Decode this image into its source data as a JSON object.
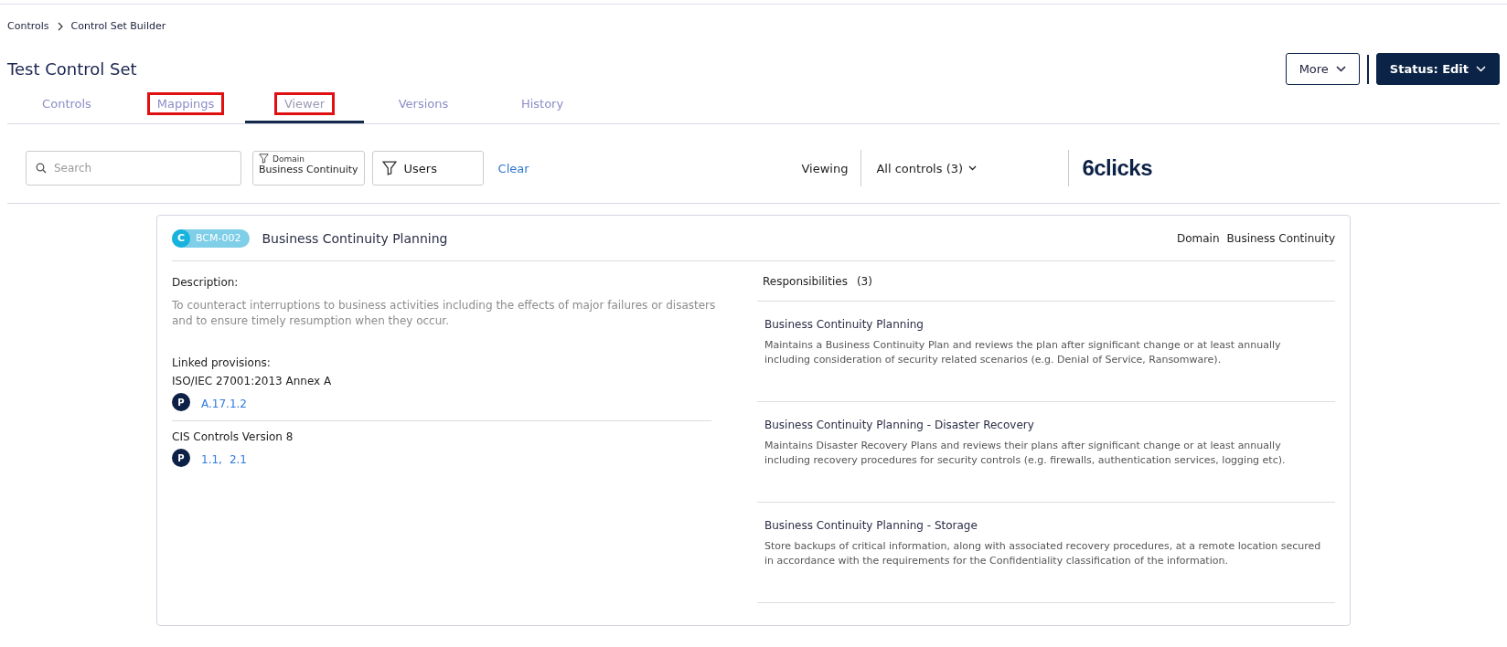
{
  "breadcrumb": [
    {
      "label": "Controls"
    },
    {
      "label": "Control Set Builder"
    }
  ],
  "title": "Test Control Set",
  "header_buttons": [
    {
      "label": "More",
      "kind": "outline"
    },
    {
      "label": "Status: Edit",
      "kind": "solid"
    }
  ],
  "tabs": [
    {
      "label": "Controls",
      "selected": false,
      "highlighted": false
    },
    {
      "label": "Mappings",
      "selected": false,
      "highlighted": true
    },
    {
      "label": "Viewer",
      "selected": true,
      "highlighted": true
    },
    {
      "label": "Versions",
      "selected": false,
      "highlighted": false
    },
    {
      "label": "History",
      "selected": false,
      "highlighted": false
    }
  ],
  "filters": {
    "search_placeholder": "Search",
    "domain_filter": {
      "caption": "Domain",
      "value": "Business Continuity"
    },
    "users_filter": "Users",
    "clear": "Clear",
    "viewing_label": "Viewing",
    "viewing_value": "All controls (3)",
    "logo": "6clicks"
  },
  "control": {
    "type_badge": "C",
    "code": "BCM-002",
    "name": "Business Continuity Planning",
    "domain_label": "Domain",
    "domain_value": "Business Continuity",
    "description_label": "Description:",
    "description": "To counteract interruptions to business activities including the effects of major failures or disasters and to ensure timely resumption when they occur.",
    "linked_label": "Linked provisions:",
    "provisions": [
      {
        "framework": "ISO/IEC 27001:2013 Annex A",
        "badge": "P",
        "links": [
          "A.17.1.2"
        ]
      },
      {
        "framework": "CIS Controls Version 8",
        "badge": "P",
        "links": [
          "1.1,",
          "2.1"
        ]
      }
    ],
    "responsibilities_label": "Responsibilities",
    "responsibilities_count": "(3)",
    "responsibilities": [
      {
        "title": "Business Continuity Planning",
        "text": "Maintains a Business Continuity Plan and reviews the plan after significant change or at least annually including consideration of security related scenarios (e.g. Denial of Service, Ransomware)."
      },
      {
        "title": "Business Continuity Planning - Disaster Recovery",
        "text": "Maintains Disaster Recovery Plans and reviews their plans after significant change or at least annually including recovery procedures for security controls (e.g. firewalls, authentication services, logging etc)."
      },
      {
        "title": "Business Continuity Planning - Storage",
        "text": "Store backups of critical information, along with associated recovery procedures, at a remote location secured in accordance with the requirements for the Confidentiality classification of the information."
      }
    ]
  }
}
